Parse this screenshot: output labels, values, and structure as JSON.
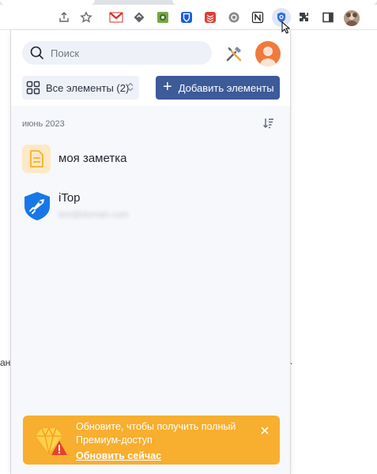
{
  "popup": {
    "search": {
      "placeholder": "Поиск"
    },
    "filter": {
      "label": "Все элементы (2)"
    },
    "add_button": {
      "plus": "+",
      "label": "Добавить элементы"
    },
    "month_label": "июнь 2023",
    "items": [
      {
        "title": "моя заметка",
        "icon": "note-icon",
        "type": "note"
      },
      {
        "title": "iTop",
        "subtitle": "text@domain.com",
        "icon": "itop-logo-icon",
        "type": "login"
      }
    ],
    "banner": {
      "message": "Обновите, чтобы получить полный Премиум-доступ",
      "link": "Обновить сейчас",
      "icon": "crown-warning-icon"
    }
  },
  "browser": {
    "extensions": [
      "share-icon",
      "bookmark-star-icon",
      "gmail-icon",
      "feedly-icon",
      "photo-ext-icon",
      "bitwarden-icon",
      "todoist-icon",
      "circle-ext-icon",
      "notion-icon",
      "password-manager-icon",
      "puzzle-extensions-icon",
      "side-panel-icon",
      "profile-avatar"
    ]
  },
  "page_fragments": {
    "left": "ан",
    "right": "."
  },
  "colors": {
    "accent": "#3d5a99",
    "banner": "#f8ae2e",
    "avatar": "#f07a3b",
    "note_icon": "#f5b642",
    "itop_blue": "#1877e8"
  }
}
